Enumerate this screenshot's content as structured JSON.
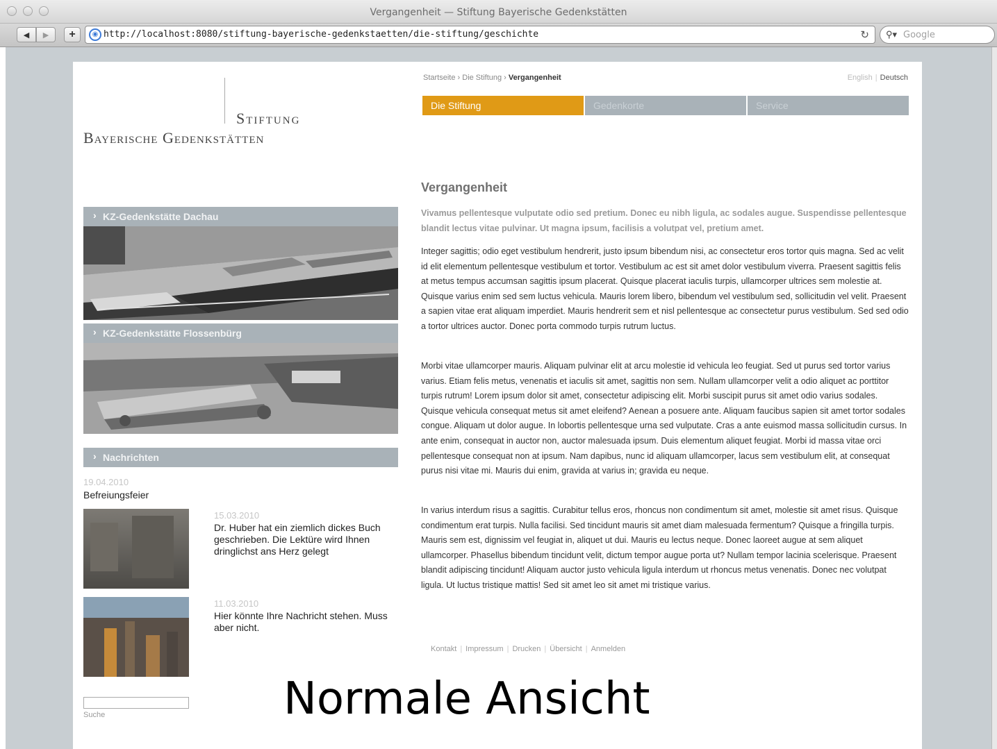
{
  "window": {
    "title": "Vergangenheit — Stiftung Bayerische Gedenkstätten"
  },
  "toolbar": {
    "back": "◀",
    "forward": "▶",
    "add": "+",
    "url": "http://localhost:8080/stiftung-bayerische-gedenkstaetten/die-stiftung/geschichte",
    "reload": "↻",
    "search_placeholder": "Google"
  },
  "logo": {
    "line1": "Stiftung",
    "line2": "Bayerische Gedenkstätten"
  },
  "breadcrumb": {
    "home": "Startseite",
    "sep": " › ",
    "section": "Die Stiftung",
    "current": "Vergangenheit"
  },
  "languages": {
    "en": "English",
    "de": "Deutsch"
  },
  "topnav": [
    {
      "label": "Die Stiftung"
    },
    {
      "label": "Gedenkorte"
    },
    {
      "label": "Service"
    }
  ],
  "sidebar": {
    "box1": "KZ-Gedenkstätte Dachau",
    "box2": "KZ-Gedenkstätte Flossenbürg",
    "news_head": "Nachrichten",
    "news": [
      {
        "date": "19.04.2010",
        "title": "Befreiungsfeier"
      },
      {
        "date": "15.03.2010",
        "title": "Dr. Huber hat ein ziemlich dickes Buch geschrieben. Die Lektüre wird Ihnen dringlichst ans Herz gelegt"
      },
      {
        "date": "11.03.2010",
        "title": "Hier könnte Ihre Nachricht stehen. Muss aber nicht."
      }
    ],
    "search_label": "Suche"
  },
  "article": {
    "title": "Vergangenheit",
    "lead": "Vivamus pellentesque vulputate odio sed pretium. Donec eu nibh ligula, ac sodales augue. Suspendisse pellentesque blandit lectus vitae pulvinar. Ut magna ipsum, facilisis a volutpat vel, pretium amet.",
    "p1": "Integer sagittis; odio eget vestibulum hendrerit, justo ipsum bibendum nisi, ac consectetur eros tortor quis magna. Sed ac velit id elit elementum pellentesque vestibulum et tortor. Vestibulum ac est sit amet dolor vestibulum viverra. Praesent sagittis felis at metus tempus accumsan sagittis ipsum placerat. Quisque placerat iaculis turpis, ullamcorper ultrices sem molestie at. Quisque varius enim sed sem luctus vehicula. Mauris lorem libero, bibendum vel vestibulum sed, sollicitudin vel velit. Praesent a sapien vitae erat aliquam imperdiet. Mauris hendrerit sem et nisl pellentesque ac consectetur purus vestibulum. Sed sed odio a tortor ultrices auctor. Donec porta commodo turpis rutrum luctus.",
    "p2": "Morbi vitae ullamcorper mauris. Aliquam pulvinar elit at arcu molestie id vehicula leo feugiat. Sed ut purus sed tortor varius varius. Etiam felis metus, venenatis et iaculis sit amet, sagittis non sem. Nullam ullamcorper velit a odio aliquet ac porttitor turpis rutrum! Lorem ipsum dolor sit amet, consectetur adipiscing elit. Morbi suscipit purus sit amet odio varius sodales. Quisque vehicula consequat metus sit amet eleifend? Aenean a posuere ante. Aliquam faucibus sapien sit amet tortor sodales congue. Aliquam ut dolor augue. In lobortis pellentesque urna sed vulputate. Cras a ante euismod massa sollicitudin cursus. In ante enim, consequat in auctor non, auctor malesuada ipsum. Duis elementum aliquet feugiat. Morbi id massa vitae orci pellentesque consequat non at ipsum. Nam dapibus, nunc id aliquam ullamcorper, lacus sem vestibulum elit, at consequat purus nisi vitae mi. Mauris dui enim, gravida at varius in; gravida eu neque.",
    "p3": "In varius interdum risus a sagittis. Curabitur tellus eros, rhoncus non condimentum sit amet, molestie sit amet risus. Quisque condimentum erat turpis. Nulla facilisi. Sed tincidunt mauris sit amet diam malesuada fermentum? Quisque a fringilla turpis. Mauris sem est, dignissim vel feugiat in, aliquet ut dui. Mauris eu lectus neque. Donec laoreet augue at sem aliquet ullamcorper. Phasellus bibendum tincidunt velit, dictum tempor augue porta ut? Nullam tempor lacinia scelerisque. Praesent blandit adipiscing tincidunt! Aliquam auctor justo vehicula ligula interdum ut rhoncus metus venenatis. Donec nec volutpat ligula. Ut luctus tristique mattis! Sed sit amet leo sit amet mi tristique varius."
  },
  "footer": [
    "Kontakt",
    "Impressum",
    "Drucken",
    "Übersicht",
    "Anmelden"
  ],
  "caption": "Normale Ansicht",
  "colors": {
    "accent": "#e09a16",
    "nav_gray": "#a9b2b8",
    "background": "#c8ced2"
  }
}
